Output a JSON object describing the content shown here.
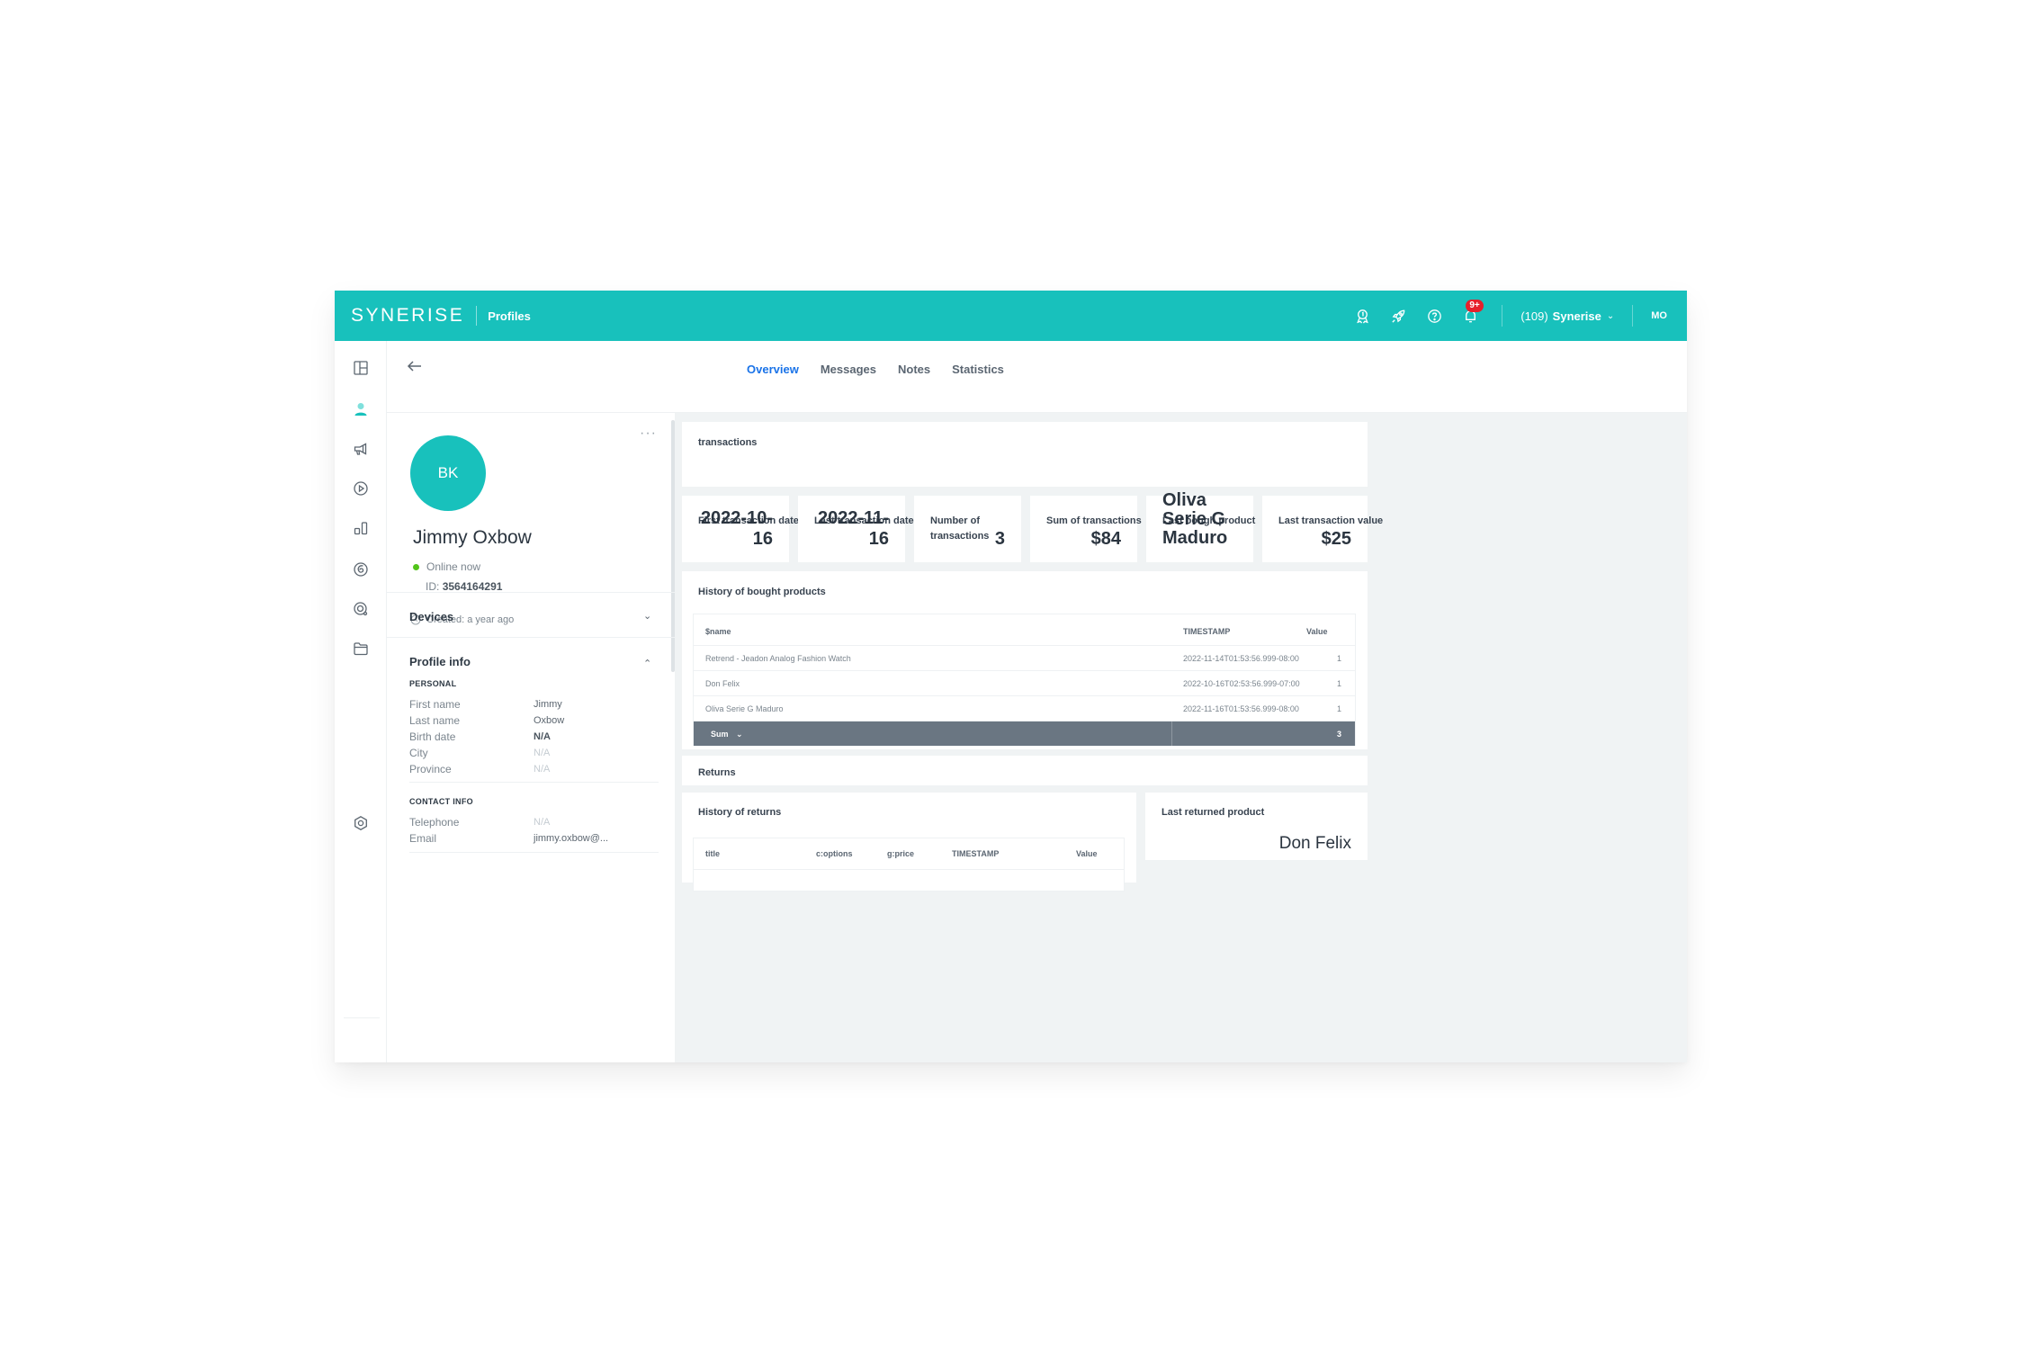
{
  "topbar": {
    "logo": "synerise",
    "app_name": "Profiles",
    "icons": [
      "achievements-icon",
      "rocket-icon",
      "help-icon",
      "notifications-icon"
    ],
    "notification_badge": "9+",
    "workspace_count": "(109)",
    "workspace_name": "Synerise",
    "user_initials": "MO",
    "brand_color": "#18c1bc"
  },
  "rail": {
    "items": [
      {
        "icon": "dashboard-icon",
        "active": false
      },
      {
        "icon": "profiles-icon",
        "active": true
      },
      {
        "icon": "campaigns-icon",
        "active": false
      },
      {
        "icon": "automation-icon",
        "active": false
      },
      {
        "icon": "analytics-icon",
        "active": false
      },
      {
        "icon": "ai-icon",
        "active": false
      },
      {
        "icon": "data-search-icon",
        "active": false
      },
      {
        "icon": "assets-folder-icon",
        "active": false
      }
    ],
    "bottom_icon": "settings-icon"
  },
  "tabs": [
    {
      "label": "Overview",
      "active": true
    },
    {
      "label": "Messages",
      "active": false
    },
    {
      "label": "Notes",
      "active": false
    },
    {
      "label": "Statistics",
      "active": false
    }
  ],
  "profile": {
    "initials": "BK",
    "name": "Jimmy Oxbow",
    "status": "Online now",
    "id_label": "ID:",
    "id_value": "3564164291",
    "created": "Created: a year ago",
    "more": "···",
    "devices_label": "Devices",
    "profile_info_label": "Profile info",
    "personal_label": "PERSONAL",
    "personal": [
      {
        "label": "First name",
        "value": "Jimmy",
        "state": "normal"
      },
      {
        "label": "Last name",
        "value": "Oxbow",
        "state": "normal"
      },
      {
        "label": "Birth date",
        "value": "N/A",
        "state": "bold"
      },
      {
        "label": "City",
        "value": "N/A",
        "state": "na"
      },
      {
        "label": "Province",
        "value": "N/A",
        "state": "na"
      }
    ],
    "contact_label": "CONTACT INFO",
    "contact": [
      {
        "label": "Telephone",
        "value": "N/A",
        "state": "na"
      },
      {
        "label": "Email",
        "value": "jimmy.oxbow@...",
        "state": "normal"
      }
    ]
  },
  "overview": {
    "transactions_title": "transactions",
    "stats": [
      {
        "title": "First transaction date",
        "value": "2022-10-16"
      },
      {
        "title": "Last transaction date",
        "value": "2022-11-16"
      },
      {
        "title": "Number of transactions",
        "value": "3"
      },
      {
        "title": "Sum of transactions",
        "value": "$84"
      },
      {
        "title": "Last bough product",
        "value": "Oliva Serie G Maduro"
      },
      {
        "title": "Last transaction value",
        "value": "$25"
      }
    ],
    "history_title": "History of bought products",
    "history_columns": [
      "$name",
      "TIMESTAMP",
      "Value"
    ],
    "history_rows": [
      {
        "name": "Retrend - Jeadon Analog Fashion Watch",
        "timestamp": "2022-11-14T01:53:56.999-08:00",
        "value": "1"
      },
      {
        "name": "Don Felix",
        "timestamp": "2022-10-16T02:53:56.999-07:00",
        "value": "1"
      },
      {
        "name": "Oliva Serie G Maduro",
        "timestamp": "2022-11-16T01:53:56.999-08:00",
        "value": "1"
      }
    ],
    "sum_label": "Sum",
    "sum_value": "3",
    "returns_title": "Returns",
    "returns_history_title": "History of returns",
    "returns_columns": [
      "title",
      "c:options",
      "g:price",
      "TIMESTAMP",
      "Value"
    ],
    "last_returned_title": "Last returned product",
    "last_returned_value": "Don Felix"
  }
}
